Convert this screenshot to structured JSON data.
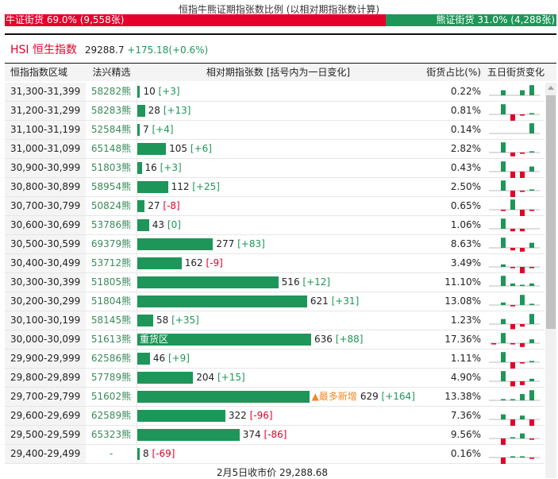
{
  "title": "恒指牛熊证期指张数比例 (以相对期指张数计算)",
  "ratio": {
    "bull_label": "牛证街货 69.0% (9,558张)",
    "bull_pct": 69.0,
    "bear_label": "熊证街货 31.0% (4,288张)",
    "bear_pct": 31.0
  },
  "index": {
    "name": "HSI 恒生指数",
    "price": "29288.7",
    "change": "+175.18(+0.6%)"
  },
  "headers": [
    "恒指指数区域",
    "法兴精选",
    "相对期指张数 [括号内为一日变化]",
    "街货占比(%)",
    "五日街货变化"
  ],
  "colors": {
    "bull": "#e4002b",
    "bear": "#1e9659",
    "highlight": "#f08a24"
  },
  "rows": [
    {
      "range": "31,300-31,399",
      "code": "58282熊",
      "count": 10,
      "count_label": "10",
      "chg": "[+3]",
      "share": "0.22%",
      "spark": [
        0,
        4,
        0,
        4,
        8
      ]
    },
    {
      "range": "31,200-31,299",
      "code": "58283熊",
      "count": 28,
      "count_label": "28",
      "chg": "[+13]",
      "share": "0.81%",
      "spark": [
        0,
        8,
        -7,
        -1,
        1
      ]
    },
    {
      "range": "31,100-31,199",
      "code": "52584熊",
      "count": 7,
      "count_label": "7",
      "chg": "[+4]",
      "share": "0.14%",
      "spark": [
        0,
        0,
        0,
        0,
        8
      ]
    },
    {
      "range": "31,000-31,099",
      "code": "65148熊",
      "count": 105,
      "count_label": "105",
      "chg": "[+6]",
      "share": "2.82%",
      "spark": [
        0,
        8,
        -3,
        -1,
        1
      ]
    },
    {
      "range": "30,900-30,999",
      "code": "51803熊",
      "count": 16,
      "count_label": "16",
      "chg": "[+3]",
      "share": "0.43%",
      "spark": [
        0,
        8,
        -6,
        -7,
        4
      ]
    },
    {
      "range": "30,800-30,899",
      "code": "58954熊",
      "count": 112,
      "count_label": "112",
      "chg": "[+25]",
      "share": "2.50%",
      "spark": [
        0,
        8,
        -8,
        -1,
        1
      ]
    },
    {
      "range": "30,700-30,799",
      "code": "50824熊",
      "count": 27,
      "count_label": "27",
      "chg": "[-8]",
      "share": "0.65%",
      "spark": [
        0,
        -1,
        8,
        -7,
        -1
      ]
    },
    {
      "range": "30,600-30,699",
      "code": "53786熊",
      "count": 43,
      "count_label": "43",
      "chg": "[0]",
      "share": "1.06%",
      "spark": [
        0,
        8,
        -2,
        -2,
        0
      ]
    },
    {
      "range": "30,500-30,599",
      "code": "69379熊",
      "count": 277,
      "count_label": "277",
      "chg": "[+83]",
      "share": "8.63%",
      "spark": [
        0,
        8,
        -2,
        -3,
        4
      ]
    },
    {
      "range": "30,400-30,499",
      "code": "53712熊",
      "count": 162,
      "count_label": "162",
      "chg": "[-9]",
      "share": "3.49%",
      "spark": [
        0,
        2,
        -1,
        -8,
        -1
      ]
    },
    {
      "range": "30,300-30,399",
      "code": "51805熊",
      "count": 516,
      "count_label": "516",
      "chg": "[+12]",
      "share": "11.10%",
      "spark": [
        0,
        8,
        2,
        1,
        2
      ]
    },
    {
      "range": "30,200-30,299",
      "code": "51804熊",
      "count": 621,
      "count_label": "621",
      "chg": "[+31]",
      "share": "13.08%",
      "spark": [
        0,
        2,
        -1,
        8,
        1
      ]
    },
    {
      "range": "30,100-30,199",
      "code": "58145熊",
      "count": 58,
      "count_label": "58",
      "chg": "[+35]",
      "share": "1.23%",
      "spark": [
        0,
        4,
        -4,
        -2,
        8
      ]
    },
    {
      "range": "30,000-30,099",
      "code": "51613熊",
      "count": 636,
      "count_label": "636",
      "chg": "[+88]",
      "share": "17.36%",
      "bar_label": "重货区",
      "spark": [
        -1,
        8,
        -1,
        -3,
        3
      ]
    },
    {
      "range": "29,900-29,999",
      "code": "62586熊",
      "count": 46,
      "count_label": "46",
      "chg": "[+9]",
      "share": "1.11%",
      "spark": [
        0,
        8,
        -6,
        -1,
        1
      ]
    },
    {
      "range": "29,800-29,899",
      "code": "57789熊",
      "count": 204,
      "count_label": "204",
      "chg": "[+15]",
      "share": "4.90%",
      "spark": [
        0,
        8,
        -4,
        -3,
        2
      ]
    },
    {
      "range": "29,700-29,799",
      "code": "51602熊",
      "count": 629,
      "count_label": "629",
      "chg": "[+164]",
      "share": "13.38%",
      "tag": "▲最多新增",
      "spark": [
        0,
        1,
        1,
        5,
        8
      ]
    },
    {
      "range": "29,600-29,699",
      "code": "62589熊",
      "count": 322,
      "count_label": "322",
      "chg": "[-96]",
      "share": "7.36%",
      "spark": [
        0,
        4,
        -8,
        3,
        -8
      ]
    },
    {
      "range": "29,500-29,599",
      "code": "65323熊",
      "count": 374,
      "count_label": "374",
      "chg": "[-86]",
      "share": "9.56%",
      "spark": [
        0,
        -8,
        1,
        4,
        -1
      ]
    },
    {
      "range": "29,400-29,499",
      "code": "-",
      "count": 8,
      "count_label": "8",
      "chg": "[-69]",
      "share": "0.16%",
      "spark": [
        0,
        -8,
        1,
        1,
        -1
      ]
    }
  ],
  "footer": "2月5日收市价 29,288.68"
}
